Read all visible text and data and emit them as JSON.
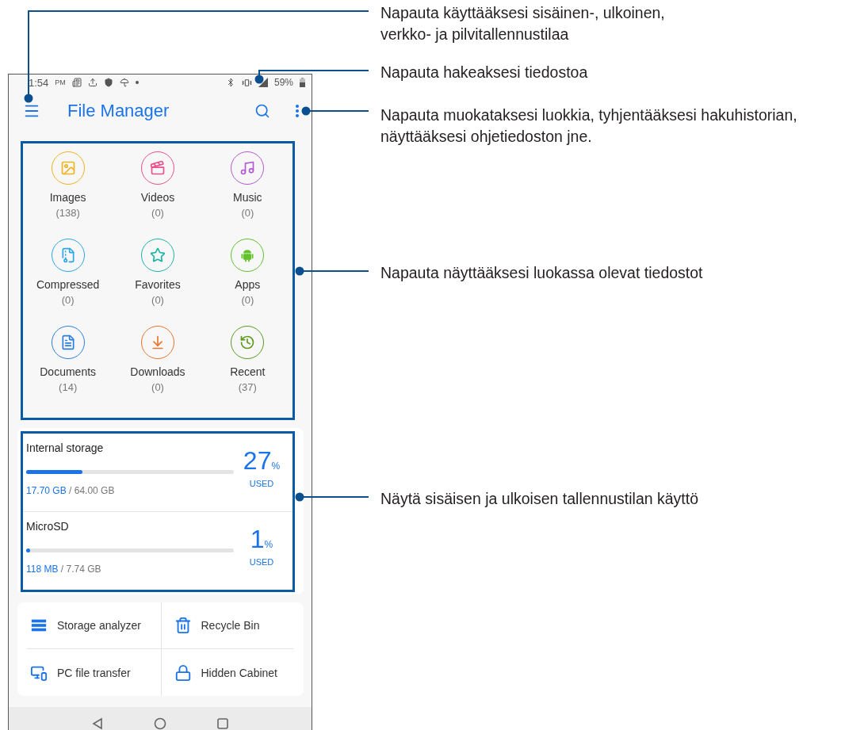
{
  "status_bar": {
    "time": "1:54",
    "ampm": "PM",
    "battery": "59%"
  },
  "app_bar": {
    "title": "File Manager"
  },
  "categories": [
    {
      "label": "Images",
      "count": "(138)",
      "color": "#f2b322"
    },
    {
      "label": "Videos",
      "count": "(0)",
      "color": "#e9508c"
    },
    {
      "label": "Music",
      "count": "(0)",
      "color": "#b45bd1"
    },
    {
      "label": "Compressed",
      "count": "(0)",
      "color": "#2aa7e8"
    },
    {
      "label": "Favorites",
      "count": "(0)",
      "color": "#19b5a5"
    },
    {
      "label": "Apps",
      "count": "(0)",
      "color": "#62c22a"
    },
    {
      "label": "Documents",
      "count": "(14)",
      "color": "#2a7fe0"
    },
    {
      "label": "Downloads",
      "count": "(0)",
      "color": "#e8762d"
    },
    {
      "label": "Recent",
      "count": "(37)",
      "color": "#5e9a1e"
    }
  ],
  "storage": [
    {
      "name": "Internal storage",
      "level": 0.27,
      "used": "17.70 GB",
      "total": "/ 64.00 GB",
      "percent": "27",
      "percent_sign": "%",
      "used_label": "USED"
    },
    {
      "name": "MicroSD",
      "level": 0.01,
      "used": "118 MB",
      "total": "/ 7.74 GB",
      "percent": "1",
      "percent_sign": "%",
      "used_label": "USED"
    }
  ],
  "tools": [
    {
      "label": "Storage analyzer"
    },
    {
      "label": "Recycle Bin"
    },
    {
      "label": "PC file transfer"
    },
    {
      "label": "Hidden Cabinet"
    }
  ],
  "callouts": [
    {
      "lines": [
        "Napauta käyttääksesi sisäinen-, ulkoinen,",
        "verkko- ja pilvitallennustilaa"
      ]
    },
    {
      "lines": [
        "Napauta hakeaksesi tiedostoa"
      ]
    },
    {
      "lines": [
        "Napauta muokataksesi luokkia, tyhjentääksesi hakuhistorian,",
        "näyttääksesi ohjetiedoston jne."
      ]
    },
    {
      "lines": [
        "Napauta näyttääksesi luokassa olevat tiedostot"
      ]
    },
    {
      "lines": [
        "Näytä sisäisen ja ulkoisen tallennustilan käyttö"
      ]
    }
  ]
}
